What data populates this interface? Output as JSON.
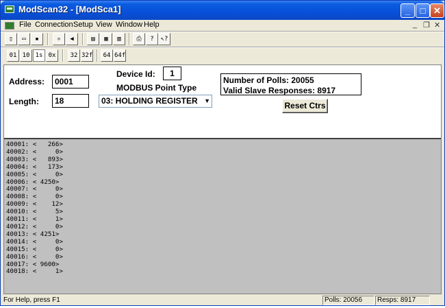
{
  "window": {
    "title": "ModScan32 - [ModSca1]",
    "controls": {
      "minimize": "_",
      "maximize": "□",
      "close": "✕"
    }
  },
  "menu": {
    "items": [
      {
        "label": "File"
      },
      {
        "label": "Connection"
      },
      {
        "label": "Setup"
      },
      {
        "label": "View"
      },
      {
        "label": "Window"
      },
      {
        "label": "Help"
      }
    ],
    "mdi_controls": [
      "_",
      "❐",
      "✕"
    ]
  },
  "toolbar1": {
    "icons": [
      "new-icon",
      "open-icon",
      "save-icon",
      "connect-icon",
      "disconnect-icon",
      "display-icon",
      "display-icon",
      "display-icon",
      "print-icon",
      "help-icon",
      "context-help-icon"
    ]
  },
  "toolbar2": {
    "buttons": [
      "01",
      "10",
      "1s",
      "0x",
      "32",
      "32f",
      "64",
      "64f"
    ]
  },
  "form": {
    "address_label": "Address:",
    "address_value": "0001",
    "length_label": "Length:",
    "length_value": "18",
    "device_id_label": "Device Id:",
    "device_id_value": "1",
    "point_type_label": "MODBUS Point Type",
    "point_type_value": "03: HOLDING REGISTER",
    "polls_label": "Number of Polls: 20055",
    "responses_label": "Valid Slave Responses: 8917",
    "reset_button": "Reset Ctrs"
  },
  "registers": [
    {
      "text": "40001: <   266>"
    },
    {
      "text": "40002: <     0>"
    },
    {
      "text": "40003: <   893>"
    },
    {
      "text": "40004: <   173>"
    },
    {
      "text": "40005: <     0>"
    },
    {
      "text": "40006: < 4250>"
    },
    {
      "text": "40007: <     0>"
    },
    {
      "text": "40008: <     0>"
    },
    {
      "text": "40009: <    12>"
    },
    {
      "text": "40010: <     5>"
    },
    {
      "text": "40011: <     1>"
    },
    {
      "text": "40012: <     0>"
    },
    {
      "text": "40013: < 4251>"
    },
    {
      "text": "40014: <     0>"
    },
    {
      "text": "40015: <     0>"
    },
    {
      "text": "40016: <     0>"
    },
    {
      "text": "40017: < 9600>"
    },
    {
      "text": "40018: <     1>"
    }
  ],
  "status": {
    "help": "For Help, press F1",
    "polls": "Polls: 20056",
    "resps": "Resps: 8917"
  }
}
